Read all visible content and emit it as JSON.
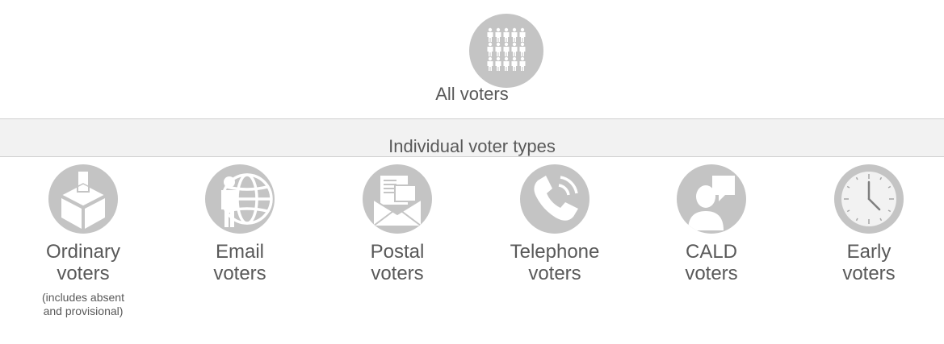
{
  "top": {
    "label": "All voters",
    "icon": "people-group-icon"
  },
  "band": {
    "label": "Individual voter types"
  },
  "types": [
    {
      "line1": "Ordinary",
      "line2": "voters",
      "note1": "(includes absent",
      "note2": "and provisional)",
      "icon": "ballot-box-icon"
    },
    {
      "line1": "Email",
      "line2": "voters",
      "icon": "person-globe-icon"
    },
    {
      "line1": "Postal",
      "line2": "voters",
      "icon": "envelope-letter-icon"
    },
    {
      "line1": "Telephone",
      "line2": "voters",
      "icon": "telephone-icon"
    },
    {
      "line1": "CALD",
      "line2": "voters",
      "icon": "person-speech-bubble-icon"
    },
    {
      "line1": "Early",
      "line2": "voters",
      "icon": "clock-icon"
    }
  ],
  "colors": {
    "icon_bg": "#c4c4c4",
    "text": "#595959",
    "band_bg": "#f2f2f2"
  }
}
